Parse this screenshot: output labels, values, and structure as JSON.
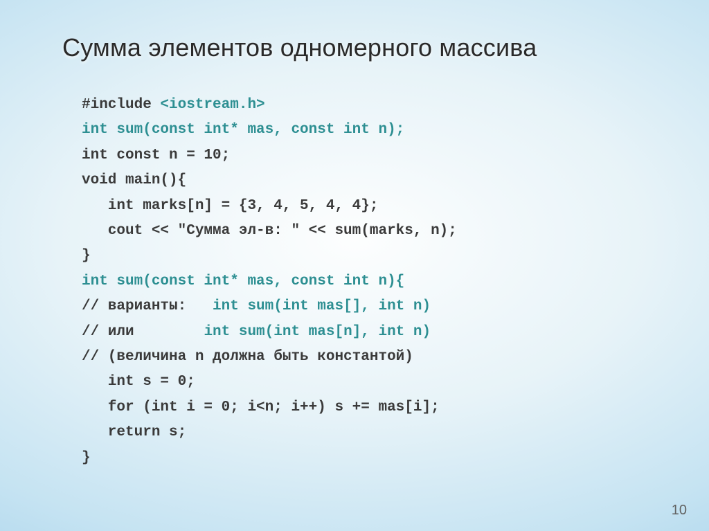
{
  "title": "Сумма элементов одномерного массива",
  "code": {
    "l1a": "#include ",
    "l1b": "<iostream.h>",
    "l2": "int sum(const int* mas, const int n);",
    "l3": "int const n = 10;",
    "l4": "void main(){",
    "l5": "   int marks[n] = {3, 4, 5, 4, 4};",
    "l6": "   cout << \"Сумма эл-в: \" << sum(marks, n);",
    "l7": "}",
    "l8": "int sum(const int* mas, const int n){",
    "l9a": "// варианты:",
    "l9b": "   int sum(int mas[], int n)",
    "l10a": "// или",
    "l10b": "        int sum(int mas[n], int n)",
    "l11": "// (величина n должна быть константой)",
    "l12": "   int s = 0;",
    "l13": "   for (int i = 0; i<n; i++) s += mas[i];",
    "l14": "   return s;",
    "l15": "}"
  },
  "page_number": "10"
}
